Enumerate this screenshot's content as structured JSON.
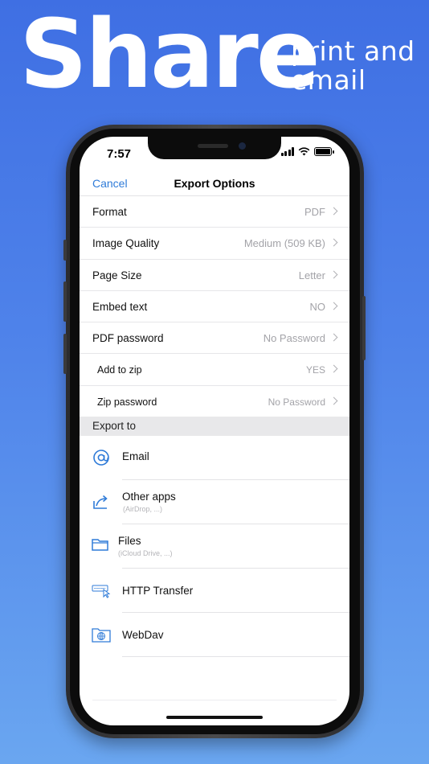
{
  "headline": {
    "big": "Share",
    "line1": "print and",
    "line2": "email"
  },
  "status_bar": {
    "time": "7:57"
  },
  "nav": {
    "cancel": "Cancel",
    "title": "Export Options"
  },
  "settings": [
    {
      "label": "Format",
      "value": "PDF"
    },
    {
      "label": "Image Quality",
      "value": "Medium (509 KB)"
    },
    {
      "label": "Page Size",
      "value": "Letter"
    },
    {
      "label": "Embed text",
      "value": "NO"
    },
    {
      "label": "PDF password",
      "value": "No Password"
    },
    {
      "label": "Add to zip",
      "value": "YES"
    },
    {
      "label": "Zip password",
      "value": "No Password"
    }
  ],
  "export_section": {
    "header": "Export to"
  },
  "exports": [
    {
      "title": "Email",
      "subtitle": "",
      "icon": "at-sign-icon"
    },
    {
      "title": "Other apps",
      "subtitle": "(AirDrop, ...)",
      "icon": "share-icon"
    },
    {
      "title": "Files",
      "subtitle": "(iCloud Drive, ...)",
      "icon": "folder-icon"
    },
    {
      "title": "HTTP Transfer",
      "subtitle": "",
      "icon": "http-transfer-icon"
    },
    {
      "title": "WebDav",
      "subtitle": "",
      "icon": "webdav-folder-icon"
    }
  ],
  "colors": {
    "accent": "#2f7bd8",
    "background_top": "#3f6fe3",
    "background_bottom": "#6aa6f0"
  }
}
